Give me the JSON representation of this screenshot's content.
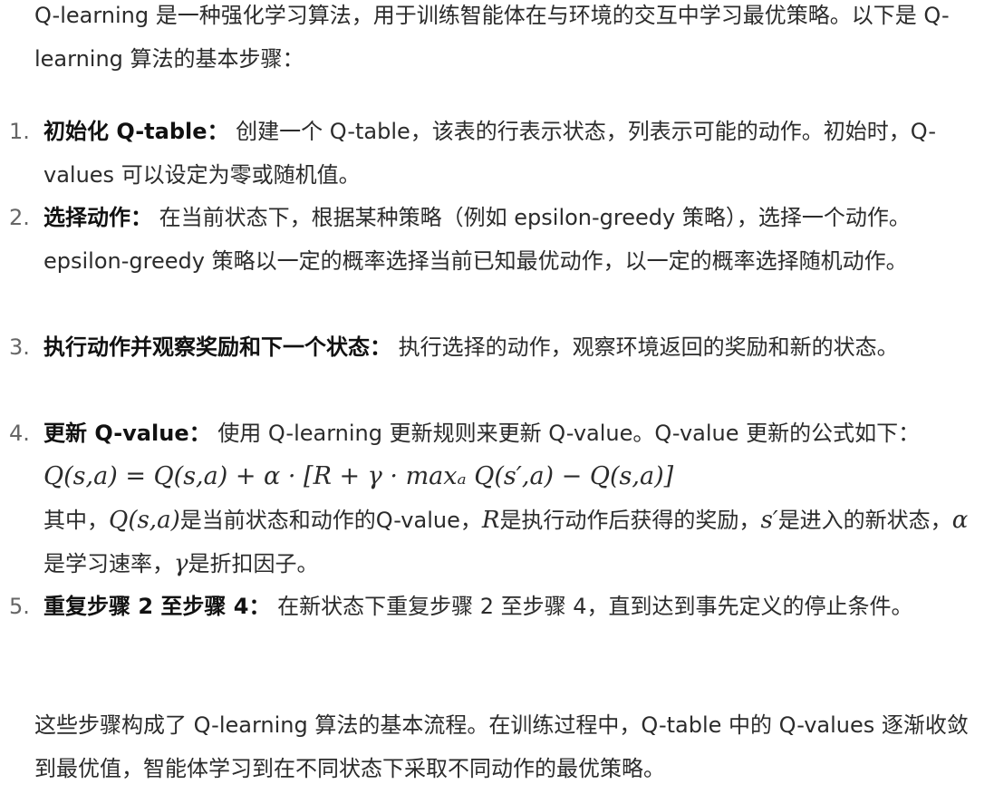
{
  "intro": "Q-learning 是一种强化学习算法，用于训练智能体在与环境的交互中学习最优策略。以下是 Q-learning 算法的基本步骤：",
  "steps": [
    {
      "num": "1.",
      "title": "初始化 Q-table：",
      "text": "创建一个 Q-table，该表的行表示状态，列表示可能的动作。初始时，Q-values 可以设定为零或随机值。"
    },
    {
      "num": "2.",
      "title": "选择动作：",
      "text": "在当前状态下，根据某种策略（例如 epsilon-greedy 策略），选择一个动作。epsilon-greedy 策略以一定的概率选择当前已知最优动作，以一定的概率选择随机动作。"
    },
    {
      "num": "3.",
      "title": "执行动作并观察奖励和下一个状态：",
      "text": "执行选择的动作，观察环境返回的奖励和新的状态。"
    },
    {
      "num": "4.",
      "title": "更新 Q-value：",
      "text": "使用 Q-learning 更新规则来更新 Q-value。Q-value 更新的公式如下：",
      "formula": "Q(s,a) = Q(s,a) + α · [R + γ · maxₐ Q(s′,a) − Q(s,a)]",
      "explain": {
        "prefix": "其中，",
        "m1": "Q(s,a)",
        "t1": "是当前状态和动作的Q-value，",
        "m2": "R",
        "t2": "是执行动作后获得的奖励，",
        "m3": "s′",
        "t3": "是进入的新状态，",
        "m4": "α",
        "t4": "是学习速率，",
        "m5": "γ",
        "t5": "是折扣因子。"
      }
    },
    {
      "num": "5.",
      "title": "重复步骤 2 至步骤 4：",
      "text": "在新状态下重复步骤 2 至步骤 4，直到达到事先定义的停止条件。"
    }
  ],
  "outro": "这些步骤构成了 Q-learning 算法的基本流程。在训练过程中，Q-table 中的 Q-values 逐渐收敛到最优值，智能体学习到在不同状态下采取不同动作的最优策略。"
}
